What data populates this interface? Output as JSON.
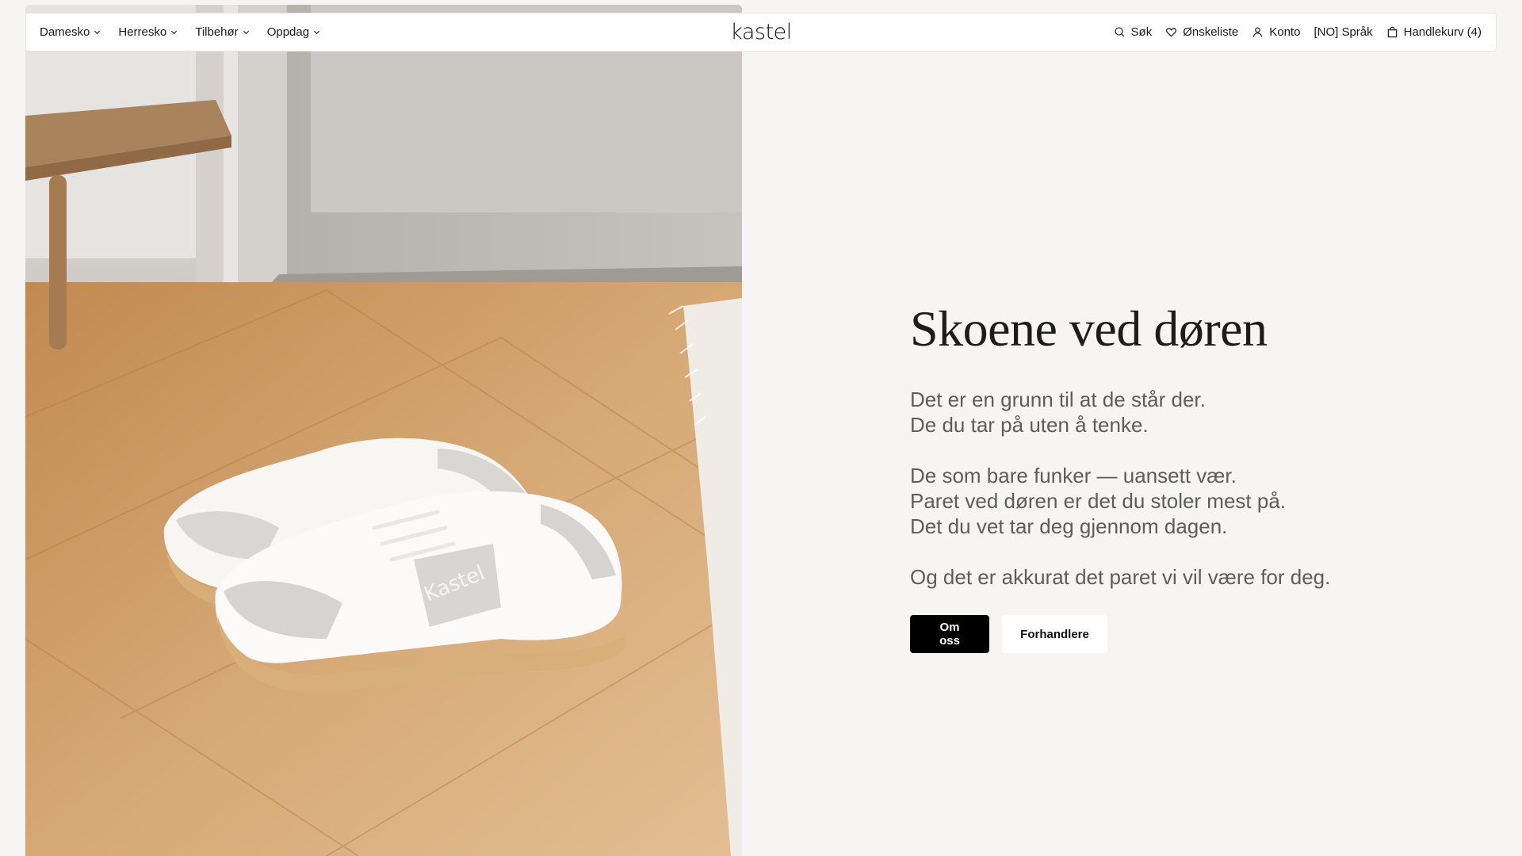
{
  "nav": {
    "left": [
      {
        "label": "Damesko"
      },
      {
        "label": "Herresko"
      },
      {
        "label": "Tilbehør"
      },
      {
        "label": "Oppdag"
      }
    ],
    "logo": "kastel",
    "right": {
      "search": "Søk",
      "wishlist": "Ønskeliste",
      "account": "Konto",
      "language": "[NO] Språk",
      "cart": "Handlekurv (4)"
    }
  },
  "hero": {
    "image_alt_brand": "Kastel",
    "headline": "Skoene ved døren",
    "paragraphs": [
      [
        "Det er en grunn til at de står der.",
        "De du tar på uten å tenke."
      ],
      [
        "De som bare funker — uansett vær.",
        "Paret ved døren er det du stoler mest på.",
        "Det du vet tar deg gjennom dagen."
      ],
      [
        "Og det er akkurat det paret vi vil være for deg."
      ]
    ],
    "buttons": {
      "primary": "Om oss",
      "secondary": "Forhandlere"
    }
  },
  "colors": {
    "page_bg": "#f6f5f3",
    "primary_button": "#000000",
    "body_text": "#5d5d5d",
    "floor_wood": "#c99a63"
  }
}
